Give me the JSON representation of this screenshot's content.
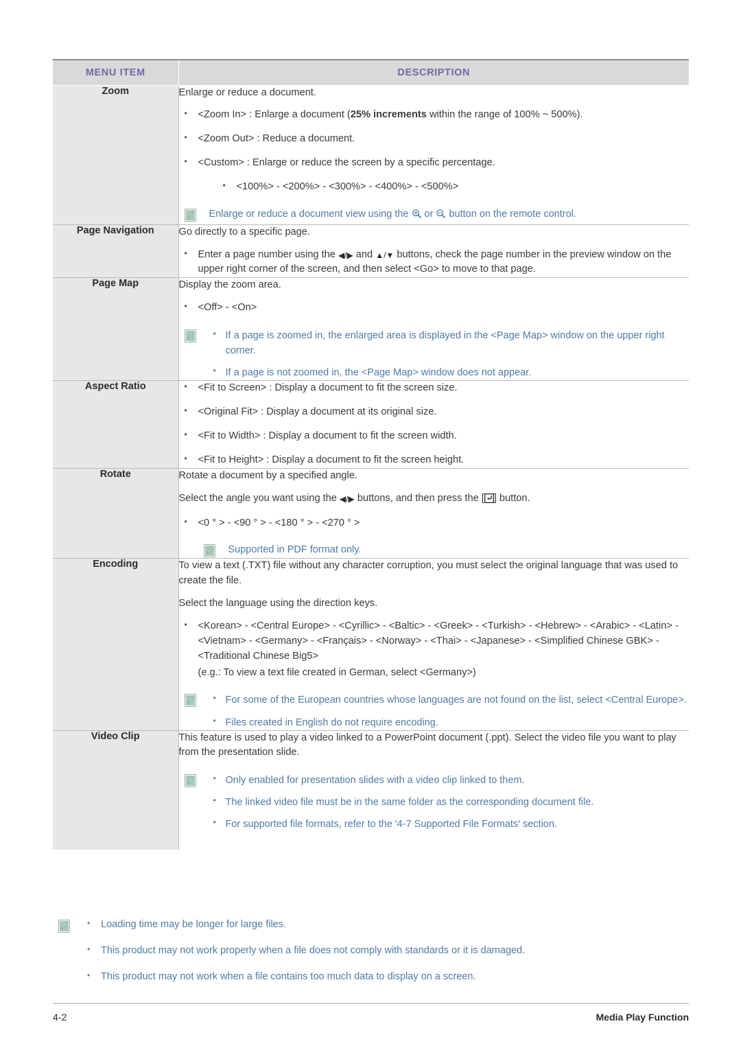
{
  "table": {
    "header": {
      "menu_item": "MENU ITEM",
      "description": "DESCRIPTION"
    },
    "header_text_color": "#6b6ba5",
    "header_bg_color": "#d9d9d9",
    "note_text_color": "#4e7ba6",
    "note_icon_color": "#a9c8b8",
    "rows": [
      {
        "menu_item": "Zoom",
        "intro": "Enlarge or reduce a document.",
        "bullets": [
          {
            "pre": "<Zoom In> : Enlarge a document (",
            "bold": "25% increments",
            "post": " within the range of 100% ~ 500%)."
          },
          {
            "text": "<Zoom Out> : Reduce a document."
          },
          {
            "text": "<Custom> : Enlarge or reduce the screen by a specific percentage."
          }
        ],
        "sub_bullets": [
          "<100%> - <200%> - <300%> - <400%> - <500%>"
        ],
        "note": {
          "pre": "Enlarge or reduce a document view using the ",
          "mid": " or ",
          "post": " button on the remote control."
        }
      },
      {
        "menu_item": "Page Navigation",
        "intro": "Go directly to a specific page.",
        "bullets": [
          {
            "pre": "Enter a page number using the ",
            "mid": " and ",
            "post": " buttons, check the page number in the preview window on the upper right corner of the screen, and then select <Go> to move to that page."
          }
        ]
      },
      {
        "menu_item": "Page Map",
        "intro": "Display the zoom area.",
        "bullets": [
          {
            "text": "<Off> - <On>"
          }
        ],
        "note_bullets": [
          "If a page is zoomed in, the enlarged area is displayed in the <Page Map> window on the upper right corner.",
          "If a page is not zoomed in, the <Page Map> window does not appear."
        ]
      },
      {
        "menu_item": "Aspect Ratio",
        "bullets": [
          {
            "text": "<Fit to Screen> : Display a document to fit the screen size."
          },
          {
            "text": "<Original Fit> : Display a document at its original size."
          },
          {
            "text": "<Fit to Width> : Display a document to fit the screen width."
          },
          {
            "text": "<Fit to Height> : Display a document to fit the screen height."
          }
        ]
      },
      {
        "menu_item": "Rotate",
        "intro": "Rotate a document by a specified angle.",
        "line2": {
          "pre": "Select the angle you want using the ",
          "mid": " buttons, and then press the [",
          "post": "] button."
        },
        "bullets": [
          {
            "text": "<0 ° > - <90 ° > - <180 ° > -  <270 ° >"
          }
        ],
        "note": {
          "text": "Supported in PDF format only."
        }
      },
      {
        "menu_item": "Encoding",
        "intro": "To view a text (.TXT) file without any character corruption, you must select the original language that was used to create the file.",
        "intro2": "Select the language using the direction keys.",
        "bullets": [
          {
            "text": "<Korean> - <Central Europe> - <Cyrillic> - <Baltic> - <Greek> - <Turkish> - <Hebrew> - <Arabic> - <Latin> - <Vietnam> - <Germany> - <Français> - <Norway> - <Thai> - <Japanese> - <Simplified Chinese GBK> - <Traditional Chinese Big5>"
          }
        ],
        "extra_line": "(e.g.: To view a text file created in German, select <Germany>)",
        "note_bullets": [
          "For some of the European countries whose languages are not found on the list, select <Central Europe>.",
          "Files created in English do not require encoding."
        ]
      },
      {
        "menu_item": "Video Clip",
        "intro": "This feature is used to play a video linked to a PowerPoint document (.ppt). Select the video file you want to play from the presentation slide.",
        "note_bullets": [
          "Only enabled for presentation slides with a video clip linked to them.",
          "The linked video file must be in the same folder as the corresponding document file.",
          "For supported file formats, refer to the '4-7 Supported File Formats' section."
        ]
      }
    ]
  },
  "footer_notes": [
    "Loading time may be longer for large files.",
    "This product may not work properly when a file does not comply with standards or it is damaged.",
    "This product may not work when a file contains too much data to display on a screen."
  ],
  "page_footer": {
    "page_number": "4-2",
    "section_title": "Media Play Function"
  },
  "icons": {
    "note": "note-pencil-icon",
    "zoom_in": "magnifier-plus-icon",
    "zoom_out": "magnifier-minus-icon",
    "left_right": "◀/▶",
    "up_down": "▲/▼",
    "enter_key": "enter-key-icon"
  }
}
